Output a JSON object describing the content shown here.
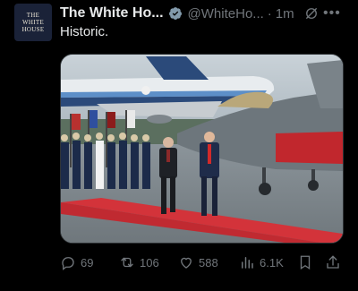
{
  "post": {
    "avatar": {
      "line1": "WHITE",
      "line2": "HOUSE",
      "prefix": "THE"
    },
    "name": "The White Ho...",
    "handle": "@WhiteHo...",
    "separator": "·",
    "time": "1m",
    "more": "•••",
    "text": "Historic."
  },
  "actions": {
    "replies": "69",
    "reposts": "106",
    "likes": "588",
    "views": "6.1K"
  },
  "colors": {
    "background": "#000000",
    "text": "#e7e9ea",
    "muted": "#71767b",
    "verified": "#829aab",
    "carpet": "#d3333a"
  }
}
